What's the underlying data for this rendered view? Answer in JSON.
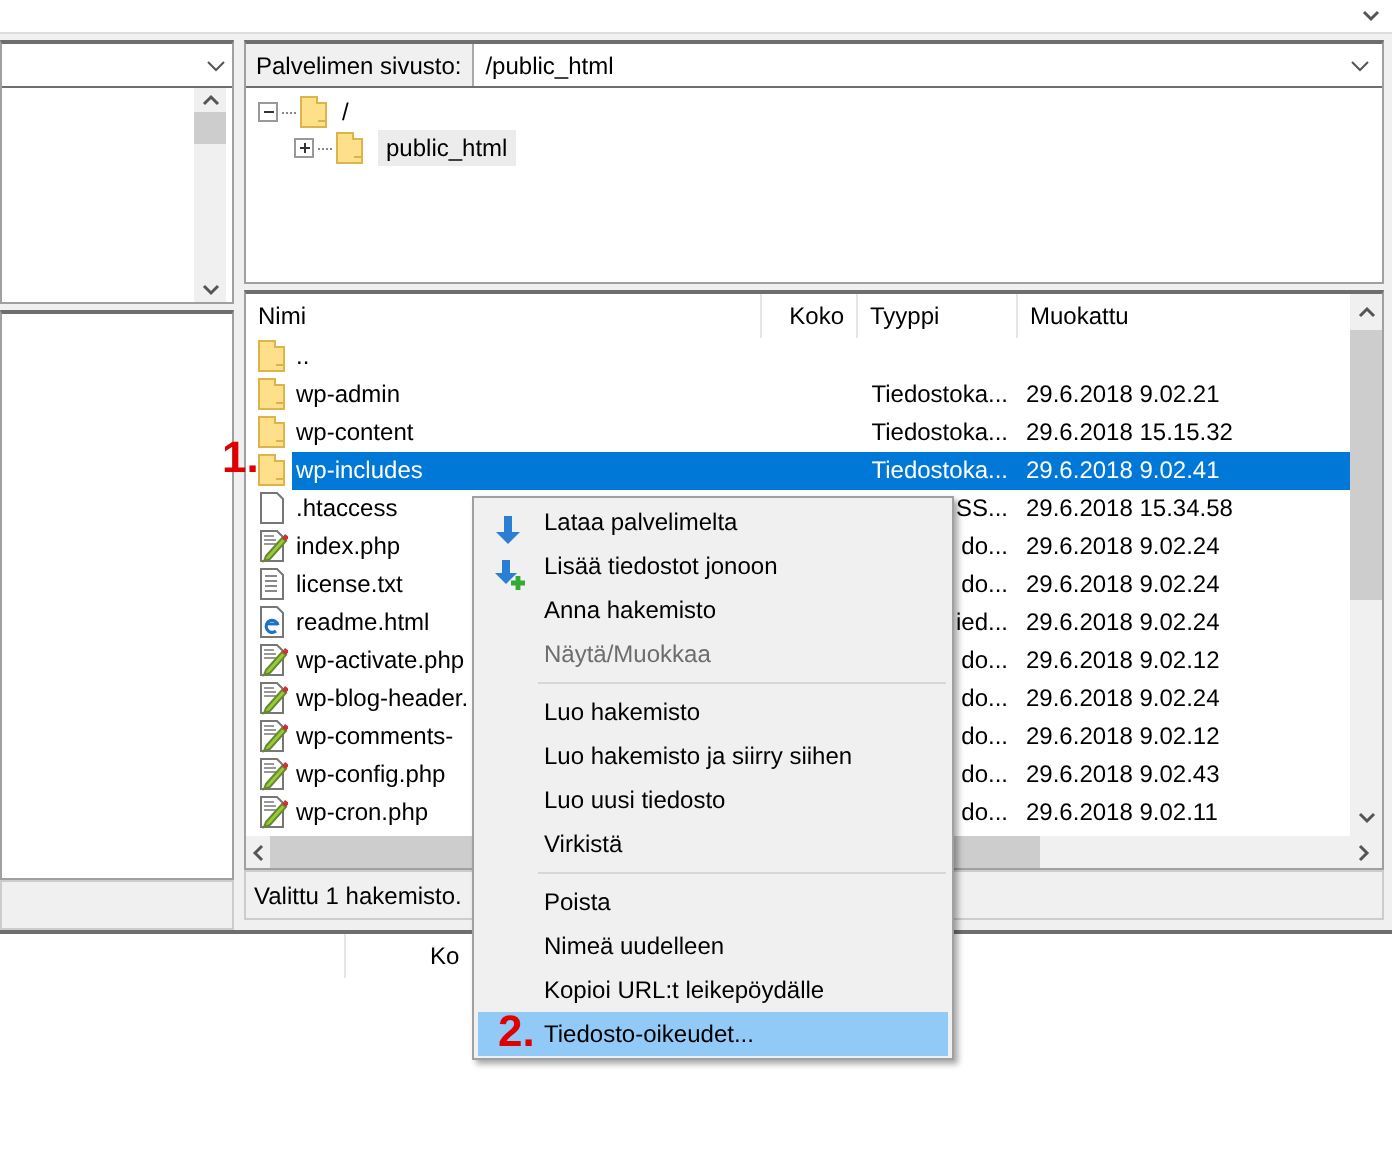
{
  "remote_site": {
    "label": "Palvelimen sivusto:",
    "path": "/public_html",
    "tree": [
      {
        "label": "/",
        "expanded": true,
        "selected": false,
        "children": [
          {
            "label": "public_html",
            "expanded": false,
            "selected": true
          }
        ]
      }
    ]
  },
  "file_list": {
    "columns": [
      "Nimi",
      "Koko",
      "Tyyppi",
      "Muokattu"
    ],
    "rows": [
      {
        "kind": "folder",
        "name": "..",
        "selected": false
      },
      {
        "kind": "folder",
        "name": "wp-admin",
        "type": "Tiedostoka...",
        "modified": "29.6.2018 9.02.21",
        "selected": false
      },
      {
        "kind": "folder",
        "name": "wp-content",
        "type": "Tiedostoka...",
        "modified": "29.6.2018 15.15.32",
        "selected": false
      },
      {
        "kind": "folder",
        "name": "wp-includes",
        "type": "Tiedostoka...",
        "modified": "29.6.2018 9.02.41",
        "selected": true,
        "marker": "1."
      },
      {
        "kind": "file",
        "name": ".htaccess",
        "type": "SS...",
        "modified": "29.6.2018 15.34.58",
        "selected": false
      },
      {
        "kind": "php",
        "name": "index.php",
        "type": "do...",
        "modified": "29.6.2018 9.02.24",
        "selected": false
      },
      {
        "kind": "text",
        "name": "license.txt",
        "type": "do...",
        "modified": "29.6.2018 9.02.24",
        "selected": false
      },
      {
        "kind": "html",
        "name": "readme.html",
        "type": "ied...",
        "modified": "29.6.2018 9.02.24",
        "selected": false
      },
      {
        "kind": "php",
        "name": "wp-activate.php",
        "type": "do...",
        "modified": "29.6.2018 9.02.12",
        "selected": false
      },
      {
        "kind": "php",
        "name": "wp-blog-header.",
        "type": "do...",
        "modified": "29.6.2018 9.02.24",
        "selected": false
      },
      {
        "kind": "php",
        "name": "wp-comments-",
        "type": "do...",
        "modified": "29.6.2018 9.02.12",
        "selected": false
      },
      {
        "kind": "php",
        "name": "wp-config.php",
        "type": "do...",
        "modified": "29.6.2018 9.02.43",
        "selected": false
      },
      {
        "kind": "php",
        "name": "wp-cron.php",
        "type": "do...",
        "modified": "29.6.2018 9.02.11",
        "selected": false
      }
    ],
    "status": "Valittu 1 hakemisto."
  },
  "queue": {
    "columns": [
      "Ko"
    ]
  },
  "context_menu": {
    "items": [
      {
        "kind": "download",
        "label": "Lataa palvelimelta",
        "disabled": false,
        "selected": false
      },
      {
        "kind": "enqueue",
        "label": "Lisää tiedostot jonoon",
        "disabled": false,
        "selected": false
      },
      {
        "kind": "plain",
        "label": "Anna hakemisto",
        "disabled": false,
        "selected": false
      },
      {
        "kind": "plain",
        "label": "Näytä/Muokkaa",
        "disabled": true,
        "selected": false
      },
      {
        "kind": "separator"
      },
      {
        "kind": "plain",
        "label": "Luo hakemisto",
        "disabled": false,
        "selected": false
      },
      {
        "kind": "plain",
        "label": "Luo hakemisto ja siirry siihen",
        "disabled": false,
        "selected": false
      },
      {
        "kind": "plain",
        "label": "Luo uusi tiedosto",
        "disabled": false,
        "selected": false
      },
      {
        "kind": "plain",
        "label": "Virkistä",
        "disabled": false,
        "selected": false
      },
      {
        "kind": "separator"
      },
      {
        "kind": "plain",
        "label": "Poista",
        "disabled": false,
        "selected": false
      },
      {
        "kind": "plain",
        "label": "Nimeä uudelleen",
        "disabled": false,
        "selected": false
      },
      {
        "kind": "plain",
        "label": "Kopioi URL:t leikepöydälle",
        "disabled": false,
        "selected": false
      },
      {
        "kind": "plain",
        "label": "Tiedosto-oikeudet...",
        "disabled": false,
        "selected": true,
        "marker": "2."
      }
    ]
  }
}
